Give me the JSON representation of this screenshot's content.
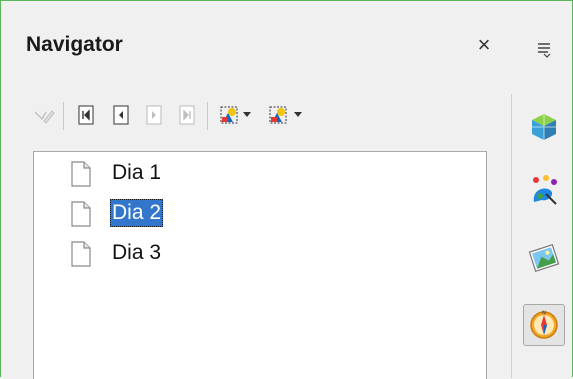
{
  "navigator": {
    "title": "Navigator",
    "close_glyph": "×",
    "toolbar_icons": [
      "show-object-icon",
      "first-slide-icon",
      "previous-slide-icon",
      "next-slide-icon",
      "last-slide-icon",
      "drag-mode-icon",
      "show-shapes-icon"
    ],
    "items": [
      {
        "label": "Dia 1",
        "selected": false
      },
      {
        "label": "Dia 2",
        "selected": true
      },
      {
        "label": "Dia 3",
        "selected": false
      }
    ]
  },
  "sidebar": {
    "menu_icon": "sidebar-menu-icon",
    "tabs": [
      "properties-icon",
      "styles-icon",
      "gallery-icon",
      "navigator-icon"
    ],
    "active_tab": "navigator-icon"
  },
  "colors": {
    "selection": "#3377cc",
    "frame_border": "#5bb55b"
  }
}
